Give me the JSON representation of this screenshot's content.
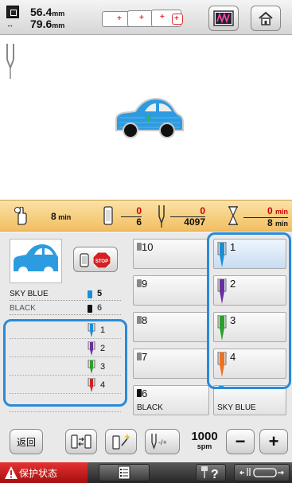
{
  "header": {
    "width_value": "56.4",
    "height_value": "79.6",
    "unit": "mm"
  },
  "time_strip": {
    "remaining_total": "8",
    "time_unit": "min",
    "color_current": "0",
    "color_total": "6",
    "stitch_current": "0",
    "stitch_total": "4097",
    "time_elapsed": "0",
    "time_total": "8"
  },
  "thread_info": [
    {
      "name": "SKY BLUE",
      "count": "5",
      "spool_color": "#1a8fd6"
    },
    {
      "name": "BLACK",
      "count": "6",
      "spool_color": "#111111"
    }
  ],
  "needle_list": [
    {
      "label": "1",
      "color": "#1a8fd6"
    },
    {
      "label": "2",
      "color": "#6a2ea0"
    },
    {
      "label": "3",
      "color": "#2aa12a"
    },
    {
      "label": "4",
      "color": "#f07020"
    }
  ],
  "color_slots": [
    {
      "label": "10",
      "name": ""
    },
    {
      "label": "9",
      "name": ""
    },
    {
      "label": "8",
      "name": ""
    },
    {
      "label": "7",
      "name": ""
    },
    {
      "label": "6",
      "name": "BLACK"
    }
  ],
  "needle_slots": [
    {
      "label": "1",
      "color": "#1a8fd6",
      "name": ""
    },
    {
      "label": "2",
      "color": "#6a2ea0",
      "name": ""
    },
    {
      "label": "3",
      "color": "#2aa12a",
      "name": ""
    },
    {
      "label": "4",
      "color": "#f07020",
      "name": ""
    },
    {
      "label": "5",
      "color": "#1a8fd6",
      "name": "SKY BLUE"
    }
  ],
  "buttons": {
    "return_label": "返回",
    "speed_value": "1000",
    "speed_unit": "spm",
    "plus": "+",
    "minus": "−"
  },
  "status": {
    "warning_label": "保护状态"
  },
  "colors": {
    "accent_blue": "#2a8ad8",
    "strip_orange": "#f2bf61",
    "warning_red": "#d42020",
    "car_blue": "#2d9be0"
  }
}
